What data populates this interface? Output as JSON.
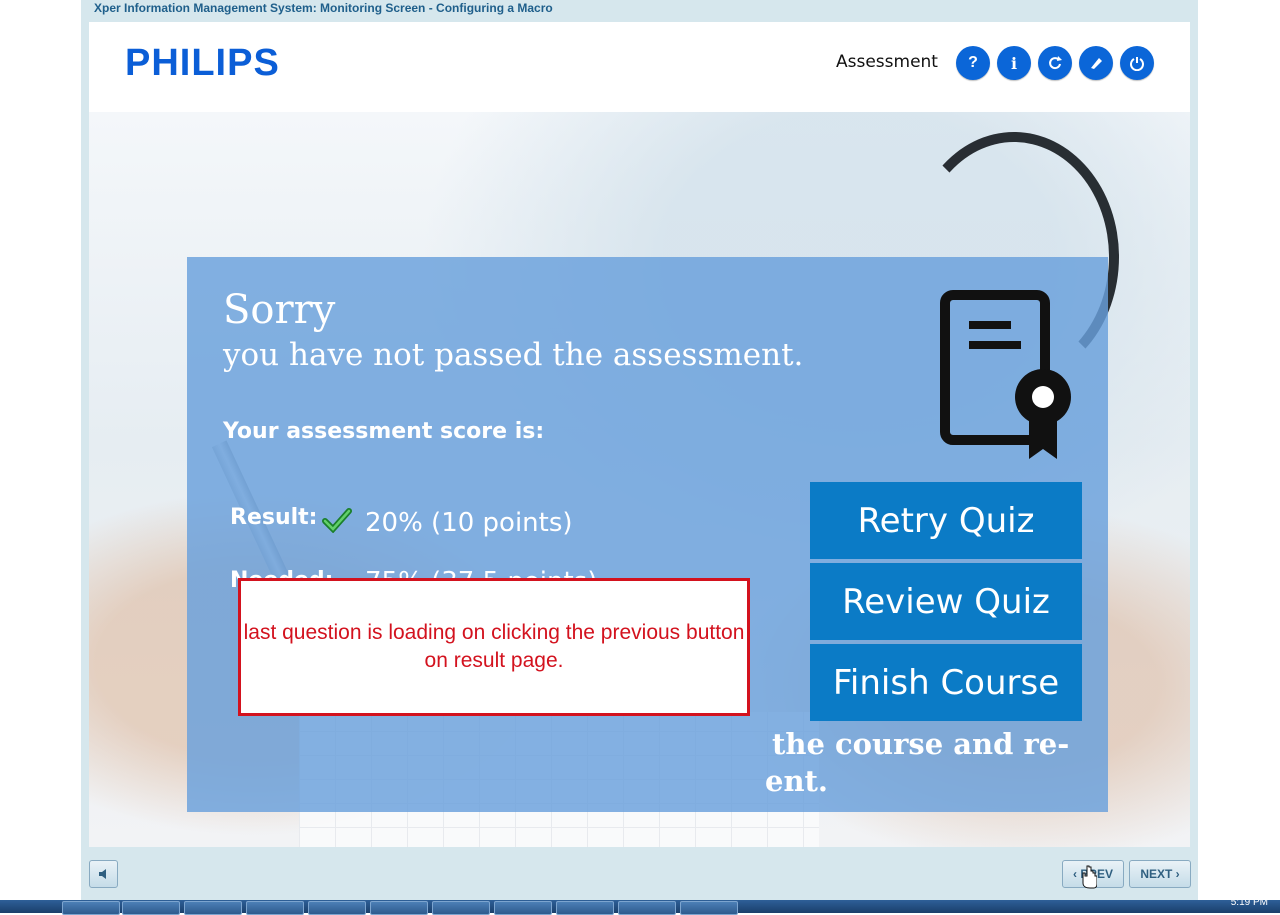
{
  "window": {
    "title": "Xper Information Management System: Monitoring Screen - Configuring a Macro"
  },
  "header": {
    "logo_text": "PHILIPS",
    "section_label": "Assessment",
    "icons": [
      "help-icon",
      "info-icon",
      "refresh-icon",
      "edit-icon",
      "power-icon"
    ],
    "help_label": "?",
    "info_label": "i"
  },
  "result": {
    "title": "Sorry",
    "subtitle": "you have not passed the assessment.",
    "score_heading": "Your assessment score is:",
    "result_label": "Result:",
    "result_value": "20% (10 points)",
    "needed_label": "Needed:",
    "needed_value": "75% (37.5 points)",
    "hidden_message_line1": "the course and re-",
    "hidden_message_line2": "ent."
  },
  "buttons": {
    "retry": "Retry Quiz",
    "review": "Review Quiz",
    "finish": "Finish Course"
  },
  "annotation": {
    "text": "last question is loading on clicking the previous button on result page."
  },
  "footer": {
    "audio_icon": "speaker-icon",
    "prev_label": "PREV",
    "next_label": "NEXT"
  },
  "taskbar": {
    "clock_text": "5:19 PM"
  },
  "colors": {
    "panel": "#69a0dc",
    "button": "#0b7bc6",
    "header_icon": "#0b66d8",
    "annotation_red": "#d3121e"
  }
}
